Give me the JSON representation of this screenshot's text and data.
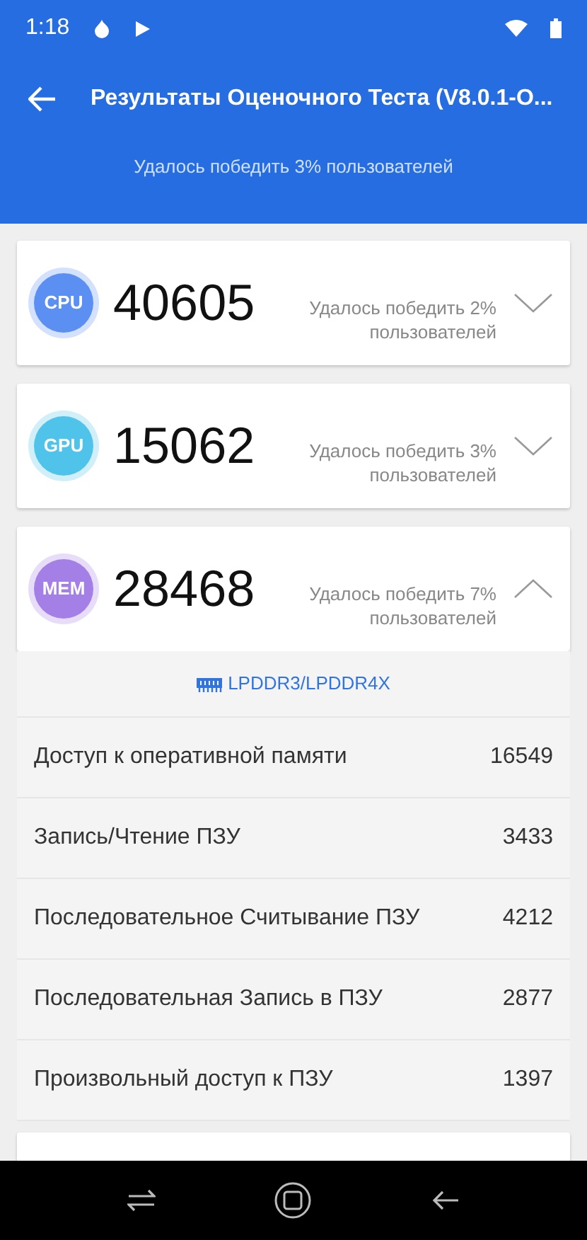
{
  "status_bar": {
    "time": "1:18"
  },
  "app_bar": {
    "title": "Результаты Оценочного Теста (V8.0.1-O..."
  },
  "header": {
    "subtitle": "Удалось победить 3% пользователей"
  },
  "scores": [
    {
      "badge": "CPU",
      "color": "#5b8ff2",
      "score": "40605",
      "note": "Удалось победить 2% пользователей",
      "expanded": false
    },
    {
      "badge": "GPU",
      "color": "#4fc3ea",
      "score": "15062",
      "note": "Удалось победить 3% пользователей",
      "expanded": false
    },
    {
      "badge": "MEM",
      "color": "#a47fe6",
      "score": "28468",
      "note": "Удалось победить 7% пользователей",
      "expanded": true
    }
  ],
  "details": {
    "memory_type": "LPDDR3/LPDDR4X",
    "rows": [
      {
        "label": "Доступ к оперативной памяти",
        "value": "16549"
      },
      {
        "label": "Запись/Чтение ПЗУ",
        "value": "3433"
      },
      {
        "label": "Последовательное Считывание ПЗУ",
        "value": "4212"
      },
      {
        "label": "Последовательная Запись в ПЗУ",
        "value": "2877"
      },
      {
        "label": "Произвольный доступ к ПЗУ",
        "value": "1397"
      }
    ]
  }
}
